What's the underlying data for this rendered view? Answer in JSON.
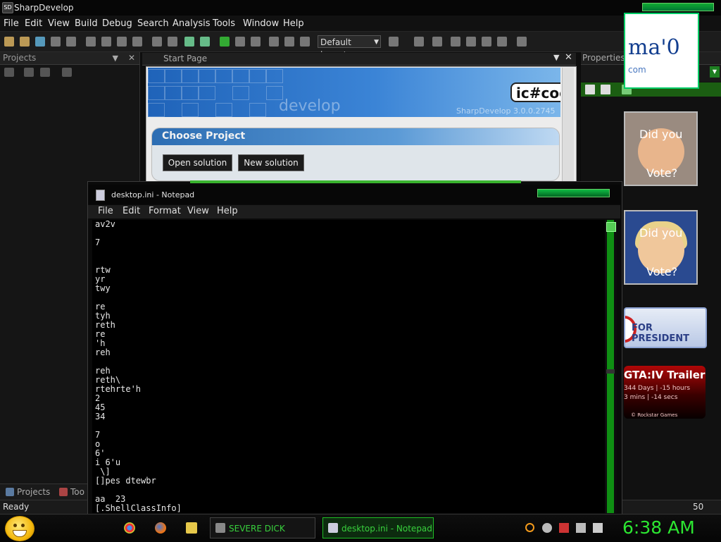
{
  "sharpdevelop": {
    "title": "SharpDevelop",
    "title_icon": "SD",
    "menu": [
      "File",
      "Edit",
      "View",
      "Build",
      "Debug",
      "Search",
      "Analysis",
      "Tools",
      "Window",
      "Help"
    ],
    "layout_select": "Default layout",
    "projects_panel": {
      "title": "Projects",
      "tabs": [
        "Projects",
        "Too"
      ]
    },
    "start_page": {
      "tab_label": "Start Page",
      "banner_text": "develop",
      "banner_logo": "ic#coc",
      "banner_version": "SharpDevelop 3.0.0.2745",
      "choose_title": "Choose Project",
      "open_button": "Open solution",
      "new_button": "New solution"
    },
    "properties_panel": {
      "title": "Properties"
    },
    "status": {
      "left": "Ready",
      "right": "50"
    }
  },
  "notepad": {
    "title": "desktop.ini - Notepad",
    "menu": [
      "File",
      "Edit",
      "Format",
      "View",
      "Help"
    ],
    "content": "av2v\n\n7\n\n\nrtw\nyr\ntwy\n\nre\ntyh\nreth\nre\n'h\nreh\n\nreh\nreth\\\nrtehrte'h\n2\n45\n34\n\n7\no\n6'\ni 6'u\n \\]\n[]pes dtewbr\n\naa  23\n[.ShellClassInfo]"
  },
  "gadgets": {
    "obama": {
      "big": "ma'0",
      "small": "com"
    },
    "vote1": {
      "line1": "Did you",
      "line2": "Vote?"
    },
    "vote2": {
      "line1": "Did you",
      "line2": "Vote?"
    },
    "president": {
      "text": "FOR PRESIDENT"
    },
    "gta": {
      "title": "GTA:IV Trailer",
      "line1": "344 Days | -15 hours",
      "line2": "3 mins | -14 secs",
      "line3": "© Rockstar Games"
    }
  },
  "taskbar": {
    "tasks": [
      {
        "label": "SEVERE DICK",
        "icon": "sharpdevelop-icon"
      },
      {
        "label": "desktop.ini - Notepad",
        "icon": "notepad-icon"
      }
    ],
    "clock": "6:38 AM"
  },
  "colors": {
    "accent_green": "#2ce631",
    "task_active_border": "#1fbf25"
  }
}
